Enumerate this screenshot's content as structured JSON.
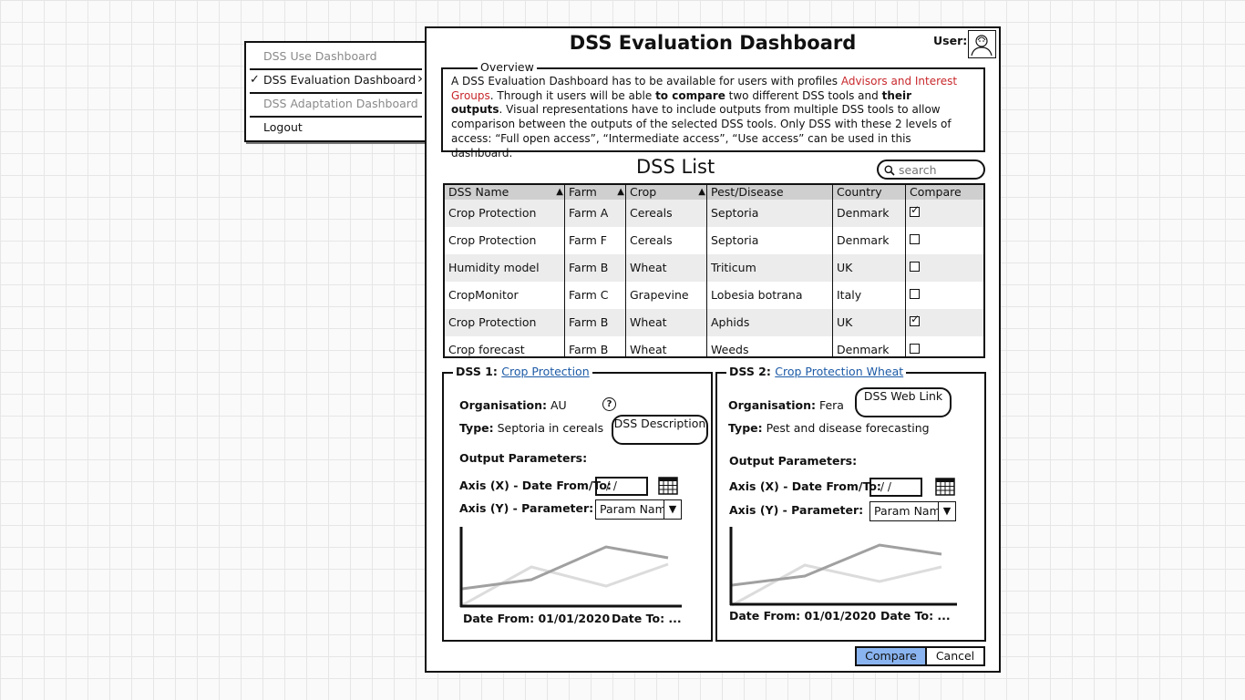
{
  "menu": {
    "items": [
      {
        "label": "DSS Use Dashboard",
        "state": "disabled"
      },
      {
        "label": "DSS Evaluation Dashboard",
        "state": "selected"
      },
      {
        "label": "DSS Adaptation Dashboard",
        "state": "disabled"
      },
      {
        "label": "Logout",
        "state": "normal"
      }
    ],
    "check_glyph": "✓",
    "submenu_glyph": "›"
  },
  "window": {
    "title": "DSS Evaluation Dashboard",
    "user_label": "User:",
    "avatar_icon": "user-avatar-icon"
  },
  "overview": {
    "legend": "Overview",
    "p1": "A DSS Evaluation Dashboard has to be available for users with profiles ",
    "p1_red": "Advisors and Interest Groups",
    "p2": ". Through it users will be able ",
    "p2_bold": "to compare",
    "p3": " two different DSS tools and ",
    "p3_bold": "their outputs",
    "p4": ". Visual representations have to include outputs from multiple DSS tools to allow comparison between the outputs of the selected DSS tools. Only DSS with these 2 levels of access: “Full open access”, “Intermediate access”, “Use access” can be used in this dashboard."
  },
  "list": {
    "title": "DSS List",
    "search_placeholder": "search",
    "columns": [
      "DSS Name",
      "Farm",
      "Crop",
      "Pest/Disease",
      "Country",
      "Compare"
    ],
    "sort_glyph": "▲",
    "rows": [
      {
        "name": "Crop Protection",
        "farm": "Farm A",
        "crop": "Cereals",
        "pest": "Septoria",
        "country": "Denmark",
        "compare": true
      },
      {
        "name": "Crop Protection",
        "farm": "Farm F",
        "crop": "Cereals",
        "pest": "Septoria",
        "country": "Denmark",
        "compare": false
      },
      {
        "name": "Humidity model",
        "farm": "Farm B",
        "crop": "Wheat",
        "pest": "Triticum",
        "country": "UK",
        "compare": false
      },
      {
        "name": "CropMonitor",
        "farm": "Farm C",
        "crop": "Grapevine",
        "pest": "Lobesia botrana",
        "country": "Italy",
        "compare": false
      },
      {
        "name": "Crop Protection",
        "farm": "Farm B",
        "crop": "Wheat",
        "pest": "Aphids",
        "country": "UK",
        "compare": true
      },
      {
        "name": "Crop forecast",
        "farm": "Farm B",
        "crop": "Wheat",
        "pest": "Weeds",
        "country": "Denmark",
        "compare": false
      }
    ]
  },
  "dss1": {
    "legend_prefix": "DSS 1: ",
    "legend_link": "Crop Protection",
    "org_label": "Organisation:",
    "org_value": " AU",
    "type_label": "Type:",
    "type_value": " Septoria in cereals",
    "help_glyph": "?",
    "bubble": "DSS Description",
    "output_label": "Output Parameters:",
    "axis_x_label": "Axis (X) - Date From/To:",
    "date_value": "/ /",
    "axis_y_label": "Axis (Y) - Parameter:",
    "param_value": "Param Name",
    "dropdown_glyph": "▼",
    "date_from": "Date From: 01/01/2020",
    "date_to": "Date To: ..."
  },
  "dss2": {
    "legend_prefix": "DSS 2: ",
    "legend_link": "Crop Protection Wheat",
    "org_label": "Organisation:",
    "org_value": " Fera",
    "type_label": "Type:",
    "type_value": " Pest and disease forecasting",
    "bubble": "DSS Web Link",
    "output_label": "Output Parameters:",
    "axis_x_label": "Axis (X) - Date From/To:",
    "date_value": "/ /",
    "axis_y_label": "Axis (Y) - Parameter:",
    "param_value": "Param Name",
    "dropdown_glyph": "▼",
    "date_from": "Date From: 01/01/2020",
    "date_to": "Date To: ..."
  },
  "buttons": {
    "compare": "Compare",
    "cancel": "Cancel"
  },
  "colors": {
    "compare_button": "#8ab4f0",
    "highlight_text": "#c8282c",
    "link": "#1c5aa6"
  }
}
